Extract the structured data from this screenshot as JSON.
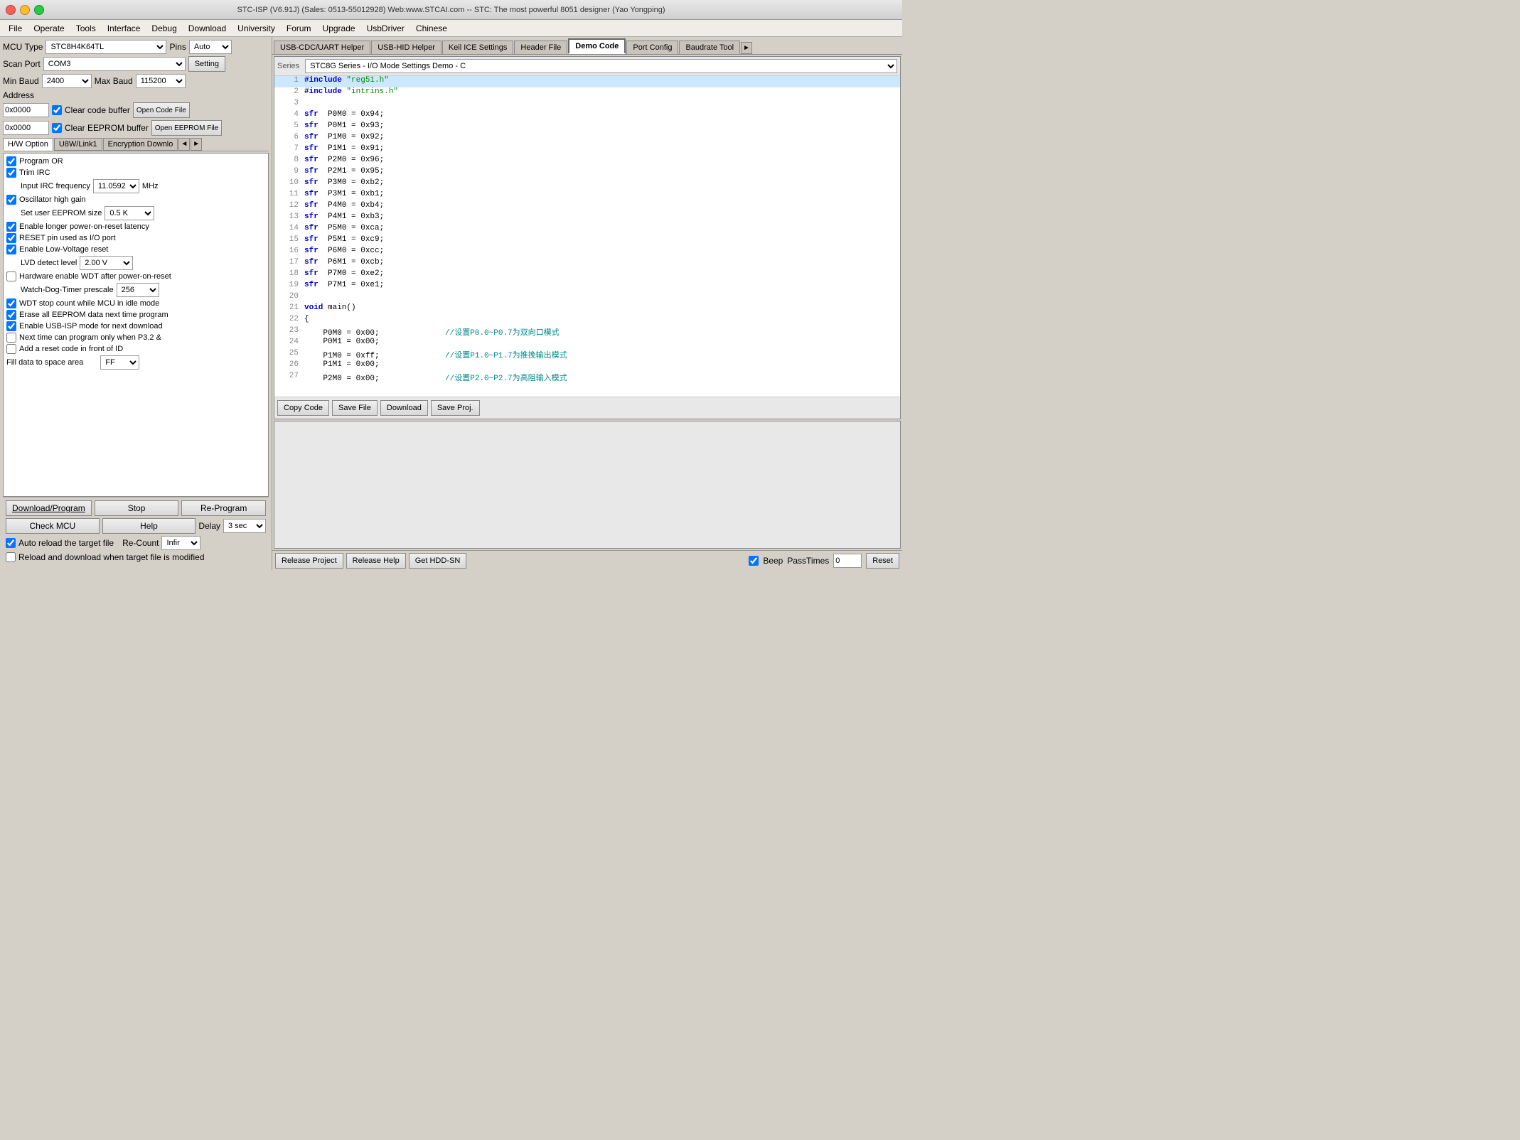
{
  "title": "STC-ISP (V6.91J) (Sales: 0513-55012928) Web:www.STCAI.com  -- STC: The most powerful 8051 designer (Yao Yongping)",
  "menu": {
    "items": [
      "File",
      "Operate",
      "Tools",
      "Interface",
      "Debug",
      "Download",
      "University",
      "Forum",
      "Upgrade",
      "UsbDriver",
      "Chinese"
    ]
  },
  "left": {
    "mcu_type_label": "MCU Type",
    "mcu_type_value": "STC8H4K64TL",
    "pins_label": "Pins",
    "pins_value": "Auto",
    "scan_port_label": "Scan Port",
    "scan_port_value": "COM3",
    "setting_label": "Setting",
    "min_baud_label": "Min Baud",
    "min_baud_value": "2400",
    "max_baud_label": "Max Baud",
    "max_baud_value": "115200",
    "address_label": "Address",
    "addr1_value": "0x0000",
    "clear_code_label": "Clear code buffer",
    "open_code_label": "Open Code File",
    "addr2_value": "0x0000",
    "clear_eeprom_label": "Clear EEPROM buffer",
    "open_eeprom_label": "Open EEPROM File",
    "tabs": [
      "H/W Option",
      "U8W/Link1",
      "Encryption Downlo"
    ],
    "options": [
      {
        "checked": true,
        "label": "Program OR"
      },
      {
        "checked": true,
        "label": "Trim IRC"
      },
      {
        "indent": true,
        "label": "Input IRC frequency",
        "input": "11.0592",
        "unit": "MHz"
      },
      {
        "checked": true,
        "label": "Oscillator high gain"
      },
      {
        "indent": true,
        "label": "Set user EEPROM size",
        "select": "0.5 K"
      },
      {
        "checked": true,
        "label": "Enable longer power-on-reset latency"
      },
      {
        "checked": true,
        "label": "RESET pin used as I/O port"
      },
      {
        "checked": true,
        "label": "Enable Low-Voltage reset"
      },
      {
        "indent": true,
        "label": "LVD detect level",
        "select": "2.00 V"
      },
      {
        "checked": false,
        "label": "Hardware enable WDT after power-on-reset"
      },
      {
        "indent": true,
        "label": "Watch-Dog-Timer prescale",
        "select": "256"
      },
      {
        "checked": true,
        "label": "WDT stop count while MCU in idle mode"
      },
      {
        "checked": true,
        "label": "Erase all EEPROM data next time program"
      },
      {
        "checked": true,
        "label": "Enable USB-ISP mode for next download"
      },
      {
        "checked": false,
        "label": "Next time can program only when P3.2 &"
      },
      {
        "checked": false,
        "label": "Add a reset code in front of ID"
      },
      {
        "label": "Fill data to space area",
        "select": "FF"
      }
    ],
    "download_btn": "Download/Program",
    "stop_btn": "Stop",
    "reprogram_btn": "Re-Program",
    "check_mcu_btn": "Check MCU",
    "help_btn": "Help",
    "delay_label": "Delay",
    "delay_value": "3 sec",
    "recount_label": "Re-Count",
    "recount_value": "Infir",
    "auto_reload_label": "Auto reload the target file",
    "reload_label": "Reload and download when target file is modified"
  },
  "right": {
    "tabs": [
      "USB-CDC/UART Helper",
      "USB-HID Helper",
      "Keil ICE Settings",
      "Header File",
      "Demo Code",
      "Port Config",
      "Baudrate Tool"
    ],
    "active_tab": "Demo Code",
    "series_label": "Series",
    "series_value": "STC8G Series - I/O Mode Settings Demo - C",
    "code_lines": [
      {
        "num": 1,
        "content": "#include \"reg51.h\"",
        "highlight": true
      },
      {
        "num": 2,
        "content": "#include \"intrins.h\""
      },
      {
        "num": 3,
        "content": ""
      },
      {
        "num": 4,
        "content": "sfr  P0M0 = 0x94;"
      },
      {
        "num": 5,
        "content": "sfr  P0M1 = 0x93;"
      },
      {
        "num": 6,
        "content": "sfr  P1M0 = 0x92;"
      },
      {
        "num": 7,
        "content": "sfr  P1M1 = 0x91;"
      },
      {
        "num": 8,
        "content": "sfr  P2M0 = 0x96;"
      },
      {
        "num": 9,
        "content": "sfr  P2M1 = 0x95;"
      },
      {
        "num": 10,
        "content": "sfr  P3M0 = 0xb2;"
      },
      {
        "num": 11,
        "content": "sfr  P3M1 = 0xb1;"
      },
      {
        "num": 12,
        "content": "sfr  P4M0 = 0xb4;"
      },
      {
        "num": 13,
        "content": "sfr  P4M1 = 0xb3;"
      },
      {
        "num": 14,
        "content": "sfr  P5M0 = 0xca;"
      },
      {
        "num": 15,
        "content": "sfr  P5M1 = 0xc9;"
      },
      {
        "num": 16,
        "content": "sfr  P6M0 = 0xcc;"
      },
      {
        "num": 17,
        "content": "sfr  P6M1 = 0xcb;"
      },
      {
        "num": 18,
        "content": "sfr  P7M0 = 0xe2;"
      },
      {
        "num": 19,
        "content": "sfr  P7M1 = 0xe1;"
      },
      {
        "num": 20,
        "content": ""
      },
      {
        "num": 21,
        "content": "void main()"
      },
      {
        "num": 22,
        "content": "{"
      },
      {
        "num": 23,
        "content": "    P0M0 = 0x00;              //设置P0.0~P0.7为双向口模式"
      },
      {
        "num": 24,
        "content": "    P0M1 = 0x00;"
      },
      {
        "num": 25,
        "content": "    P1M0 = 0xff;              //设置P1.0~P1.7为推挽输出模式"
      },
      {
        "num": 26,
        "content": "    P1M1 = 0x00;"
      },
      {
        "num": 27,
        "content": "    P2M0 = 0x00;              //设置P2.0~P2.7为高阻输入模式"
      }
    ],
    "actions": [
      "Copy Code",
      "Save File",
      "Download",
      "Save Proj."
    ],
    "status_left": [
      "Release Project",
      "Release Help",
      "Get HDD-SN"
    ],
    "beep_label": "Beep",
    "pass_times_label": "PassTimes",
    "pass_times_value": "0",
    "reset_label": "Reset"
  }
}
